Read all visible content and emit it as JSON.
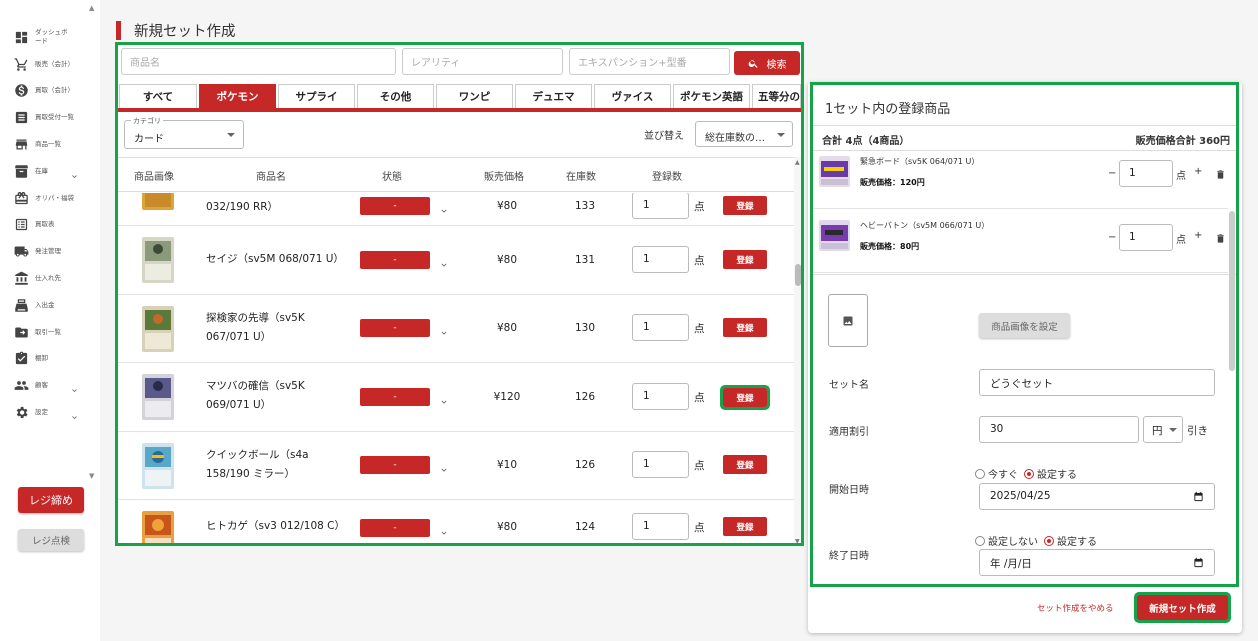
{
  "sidebar": {
    "items": [
      {
        "label": "ダッシュボード",
        "icon": "dashboard-icon"
      },
      {
        "label": "販売（会計）",
        "icon": "cart-icon"
      },
      {
        "label": "買取（会計）",
        "icon": "dollar-icon"
      },
      {
        "label": "買取受付一覧",
        "icon": "receipt-icon"
      },
      {
        "label": "商品一覧",
        "icon": "store-icon"
      },
      {
        "label": "在庫",
        "icon": "inventory-icon"
      },
      {
        "label": "オリパ・福袋",
        "icon": "gift-icon"
      },
      {
        "label": "買取表",
        "icon": "list-icon"
      },
      {
        "label": "発注管理",
        "icon": "truck-icon"
      },
      {
        "label": "仕入れ先",
        "icon": "bank-icon"
      },
      {
        "label": "入出金",
        "icon": "cash-icon"
      },
      {
        "label": "取引一覧",
        "icon": "folder-icon"
      },
      {
        "label": "棚卸",
        "icon": "checklist-icon"
      },
      {
        "label": "顧客",
        "icon": "people-icon"
      },
      {
        "label": "設定",
        "icon": "gear-icon"
      }
    ],
    "close_register": "レジ締め",
    "register_check": "レジ点検"
  },
  "page": {
    "title": "新規セット作成"
  },
  "search": {
    "name_placeholder": "商品名",
    "rarity_placeholder": "レアリティ",
    "expansion_placeholder": "エキスパンション+型番",
    "button": "検索"
  },
  "tabs": [
    "すべて",
    "ポケモン",
    "サプライ",
    "その他",
    "ワンピ",
    "デュエマ",
    "ヴァイス",
    "ポケモン英語",
    "五等分の"
  ],
  "active_tab": "ポケモン",
  "filter": {
    "category_legend": "カテゴリ",
    "category_value": "カード",
    "sort_label": "並び替え",
    "sort_value": "総在庫数の…"
  },
  "table": {
    "headers": [
      "商品画像",
      "商品名",
      "状態",
      "販売価格",
      "在庫数",
      "登録数"
    ],
    "rows": [
      {
        "name": "032/190 RR）",
        "condition": "-",
        "price": "¥80",
        "stock": "133",
        "qty": "1",
        "unit": "点",
        "button": "登録"
      },
      {
        "name": "セイジ（sv5M 068/071 U）",
        "condition": "-",
        "price": "¥80",
        "stock": "131",
        "qty": "1",
        "unit": "点",
        "button": "登録"
      },
      {
        "name": "探検家の先導（sv5K 067/071 U）",
        "condition": "-",
        "price": "¥80",
        "stock": "130",
        "qty": "1",
        "unit": "点",
        "button": "登録"
      },
      {
        "name": "マツバの確信（sv5K 069/071 U）",
        "condition": "-",
        "price": "¥120",
        "stock": "126",
        "qty": "1",
        "unit": "点",
        "button": "登録"
      },
      {
        "name": "クイックボール（s4a 158/190 ミラー）",
        "condition": "-",
        "price": "¥10",
        "stock": "126",
        "qty": "1",
        "unit": "点",
        "button": "登録"
      },
      {
        "name": "ヒトカゲ（sv3 012/108 C）",
        "condition": "-",
        "price": "¥80",
        "stock": "124",
        "qty": "1",
        "unit": "点",
        "button": "登録"
      }
    ]
  },
  "set_panel": {
    "title": "1セット内の登録商品",
    "total_label": "合計 4点（4商品）",
    "total_price": "販売価格合計 360円",
    "items": [
      {
        "name": "緊急ボード（sv5K 064/071 U）",
        "price": "販売価格：120円",
        "qty": "1",
        "unit": "点"
      },
      {
        "name": "ヘビーバトン（sv5M 066/071 U）",
        "price": "販売価格：80円",
        "qty": "1",
        "unit": "点"
      }
    ],
    "image_button": "商品画像を設定",
    "set_name_label": "セット名",
    "set_name_value": "どうぐセット",
    "discount_label": "適用割引",
    "discount_value": "30",
    "discount_unit": "円",
    "discount_suffix": "引き",
    "start_label": "開始日時",
    "start_now": "今すぐ",
    "start_set": "設定する",
    "start_value": "2025/04/25",
    "end_label": "終了日時",
    "end_none": "設定しない",
    "end_set": "設定する",
    "end_value": "年 /月/日",
    "cancel": "セット作成をやめる",
    "create": "新規セット作成"
  },
  "colors": {
    "accent": "#c62828",
    "highlight": "#16a34a"
  }
}
